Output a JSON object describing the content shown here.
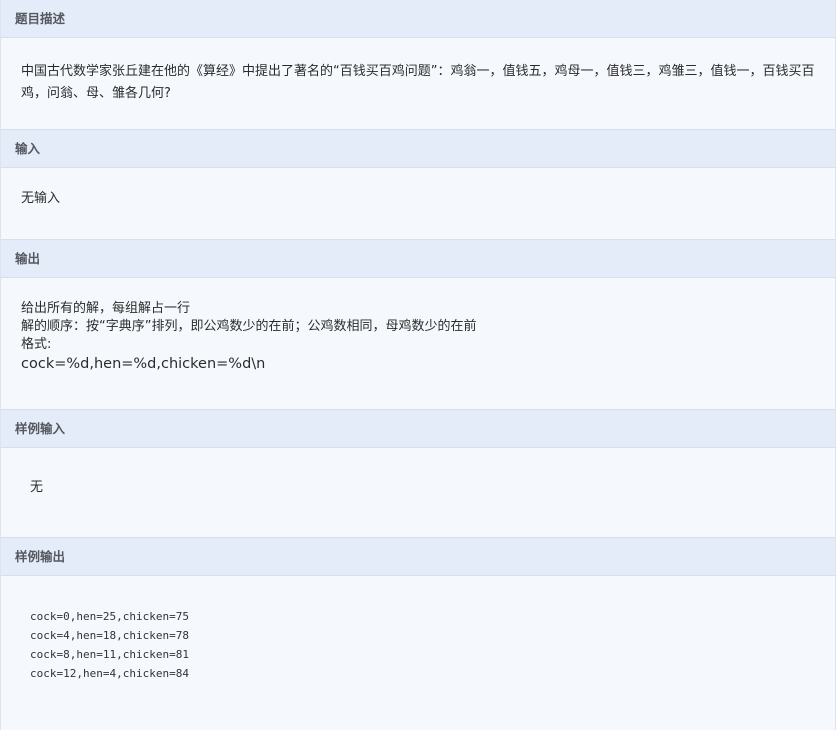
{
  "description": {
    "header": "题目描述",
    "text": "中国古代数学家张丘建在他的《算经》中提出了著名的“百钱买百鸡问题”：鸡翁一，值钱五，鸡母一，值钱三，鸡雏三，值钱一，百钱买百鸡，问翁、母、雏各几何?"
  },
  "input": {
    "header": "输入",
    "text": "无输入"
  },
  "output": {
    "header": "输出",
    "lines": [
      "给出所有的解，每组解占一行",
      "解的顺序：按“字典序”排列，即公鸡数少的在前；公鸡数相同，母鸡数少的在前",
      "格式:"
    ],
    "format": "cock=%d,hen=%d,chicken=%d\\n"
  },
  "sample_input": {
    "header": "样例输入",
    "text": "无"
  },
  "sample_output": {
    "header": "样例输出",
    "lines": [
      "cock=0,hen=25,chicken=75",
      "cock=4,hen=18,chicken=78",
      "cock=8,hen=11,chicken=81",
      "cock=12,hen=4,chicken=84"
    ]
  }
}
